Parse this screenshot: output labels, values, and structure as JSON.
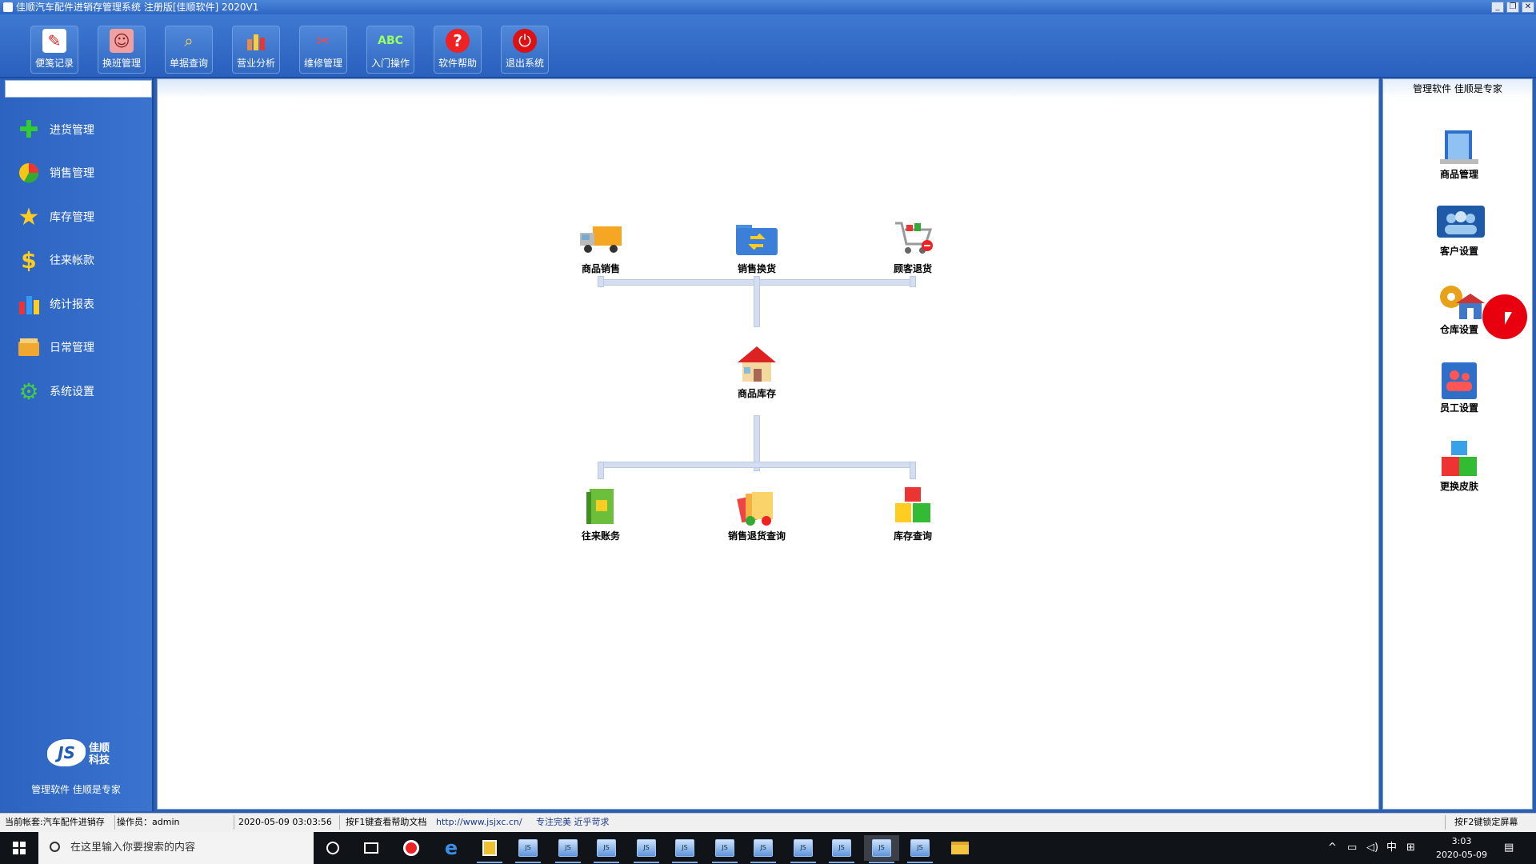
{
  "window": {
    "title": "佳顺汽车配件进销存管理系统 注册版[佳顺软件] 2020V1",
    "controls": [
      "_",
      "❐",
      "✕"
    ]
  },
  "toolbar": [
    {
      "label": "便笺记录",
      "icon": "notepad-icon"
    },
    {
      "label": "换班管理",
      "icon": "users-icon"
    },
    {
      "label": "单据查询",
      "icon": "search-icon"
    },
    {
      "label": "营业分析",
      "icon": "bar-chart-icon"
    },
    {
      "label": "维修管理",
      "icon": "tools-icon"
    },
    {
      "label": "入门操作",
      "icon": "abc-icon"
    },
    {
      "label": "软件帮助",
      "icon": "help-icon"
    },
    {
      "label": "退出系统",
      "icon": "power-icon"
    }
  ],
  "sidebar": {
    "items": [
      {
        "label": "进货管理",
        "icon": "plus-icon"
      },
      {
        "label": "销售管理",
        "icon": "pie-icon"
      },
      {
        "label": "库存管理",
        "icon": "star-icon"
      },
      {
        "label": "往来帐款",
        "icon": "dollar-icon"
      },
      {
        "label": "统计报表",
        "icon": "bar-chart-icon"
      },
      {
        "label": "日常管理",
        "icon": "folder-icon"
      },
      {
        "label": "系统设置",
        "icon": "gear-icon"
      }
    ],
    "logo_text": "JS",
    "logo_company_line1": "佳顺",
    "logo_company_line2": "科技",
    "slogan": "管理软件 佳顺是专家"
  },
  "flow": {
    "top": [
      {
        "label": "商品销售",
        "icon": "truck-icon"
      },
      {
        "label": "销售换货",
        "icon": "exchange-folder-icon"
      },
      {
        "label": "顾客退货",
        "icon": "cart-icon"
      }
    ],
    "center": {
      "label": "商品库存",
      "icon": "house-icon"
    },
    "bottom": [
      {
        "label": "往来账务",
        "icon": "ledger-icon"
      },
      {
        "label": "销售退货查询",
        "icon": "files-icon"
      },
      {
        "label": "库存查询",
        "icon": "boxes-icon"
      }
    ]
  },
  "right_panel": {
    "header": "管理软件 佳顺是专家",
    "items": [
      {
        "label": "商品管理",
        "icon": "document-stack-icon"
      },
      {
        "label": "客户设置",
        "icon": "customers-icon"
      },
      {
        "label": "仓库设置",
        "icon": "warehouse-icon"
      },
      {
        "label": "员工设置",
        "icon": "employee-icon"
      },
      {
        "label": "更换皮肤",
        "icon": "cubes-icon"
      }
    ]
  },
  "statusbar": {
    "account": "当前帐套:汽车配件进销存",
    "operator": "操作员：admin",
    "datetime": "2020-05-09 03:03:56",
    "help_hint": "按F1键查看帮助文档",
    "url": "http://www.jsjxc.cn/",
    "motto": "专注完美 近乎苛求",
    "lock_hint": "按F2键锁定屏幕"
  },
  "taskbar": {
    "search_placeholder": "在这里输入你要搜索的内容",
    "ime": "中",
    "time": "3:03",
    "date": "2020-05-09",
    "app_label": "JS"
  },
  "colors": {
    "accent": "#2a5fb3",
    "cursor_highlight": "#e8000e"
  }
}
